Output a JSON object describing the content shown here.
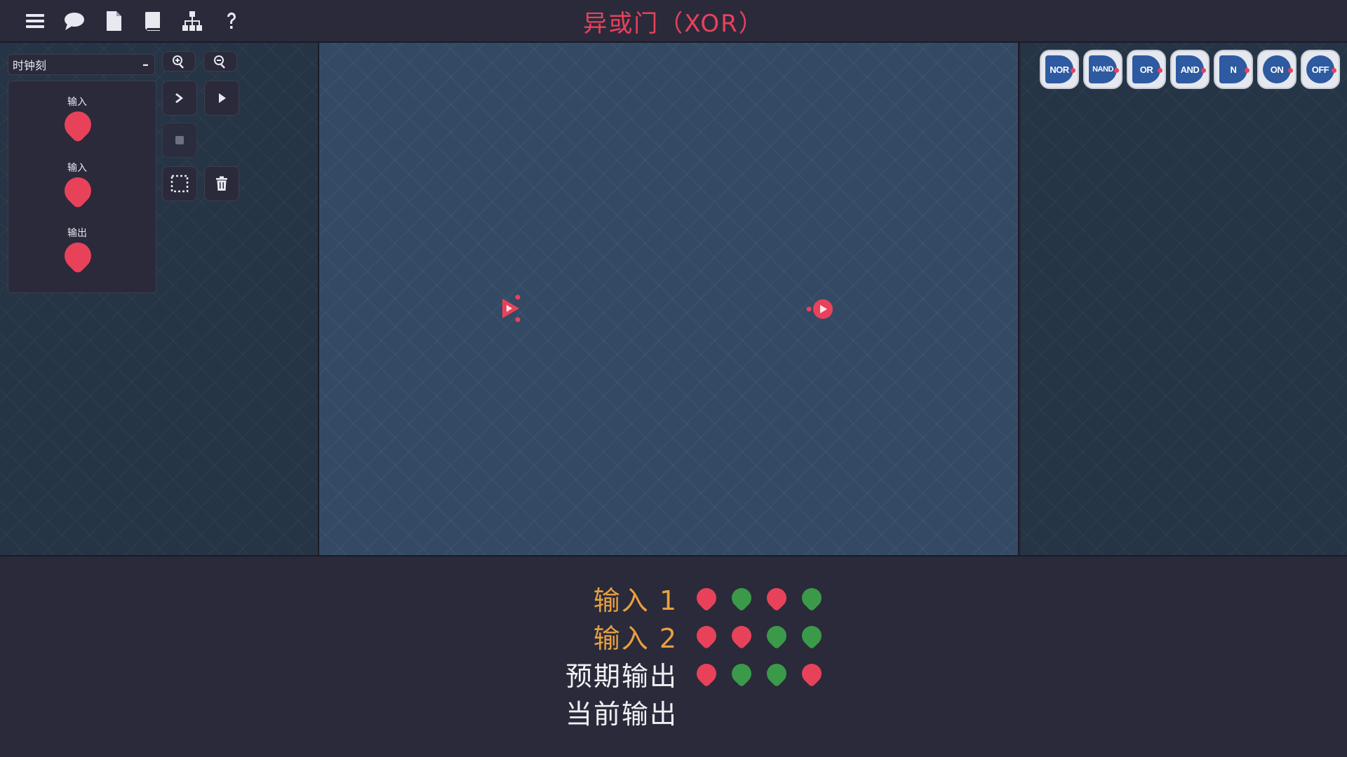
{
  "app": {
    "level_title": "异或门（XOR）",
    "title_color": "#e8425a"
  },
  "toolbar": {
    "icons": [
      "menu-icon",
      "comment-icon",
      "file-icon",
      "book-icon",
      "hierarchy-icon",
      "help-icon"
    ]
  },
  "sidebar": {
    "speed_select": {
      "value": "时钟刻",
      "action": "–"
    },
    "io_items": [
      {
        "label": "输入",
        "state": "off"
      },
      {
        "label": "输入",
        "state": "off"
      },
      {
        "label": "输出",
        "state": "off"
      }
    ],
    "controls": [
      "zoom-in-icon",
      "zoom-out-icon",
      "step-icon",
      "play-icon",
      "stop-icon",
      "select-all-icon",
      "trash-icon"
    ]
  },
  "gate_palette": [
    "NOR",
    "NAND",
    "OR",
    "AND",
    "N",
    "ON",
    "OFF"
  ],
  "truth_table": {
    "colors": {
      "off": "#e8425a",
      "on": "#3a9a4a"
    },
    "rows": [
      {
        "label": "输入 1",
        "label_color": "#e8a040",
        "values": [
          "off",
          "on",
          "off",
          "on"
        ]
      },
      {
        "label": "输入 2",
        "label_color": "#e8a040",
        "values": [
          "off",
          "off",
          "on",
          "on"
        ]
      },
      {
        "label": "预期输出",
        "label_color": "#f0f0f4",
        "values": [
          "off",
          "on",
          "on",
          "off"
        ]
      },
      {
        "label": "当前输出",
        "label_color": "#f0f0f4",
        "values": []
      }
    ]
  }
}
